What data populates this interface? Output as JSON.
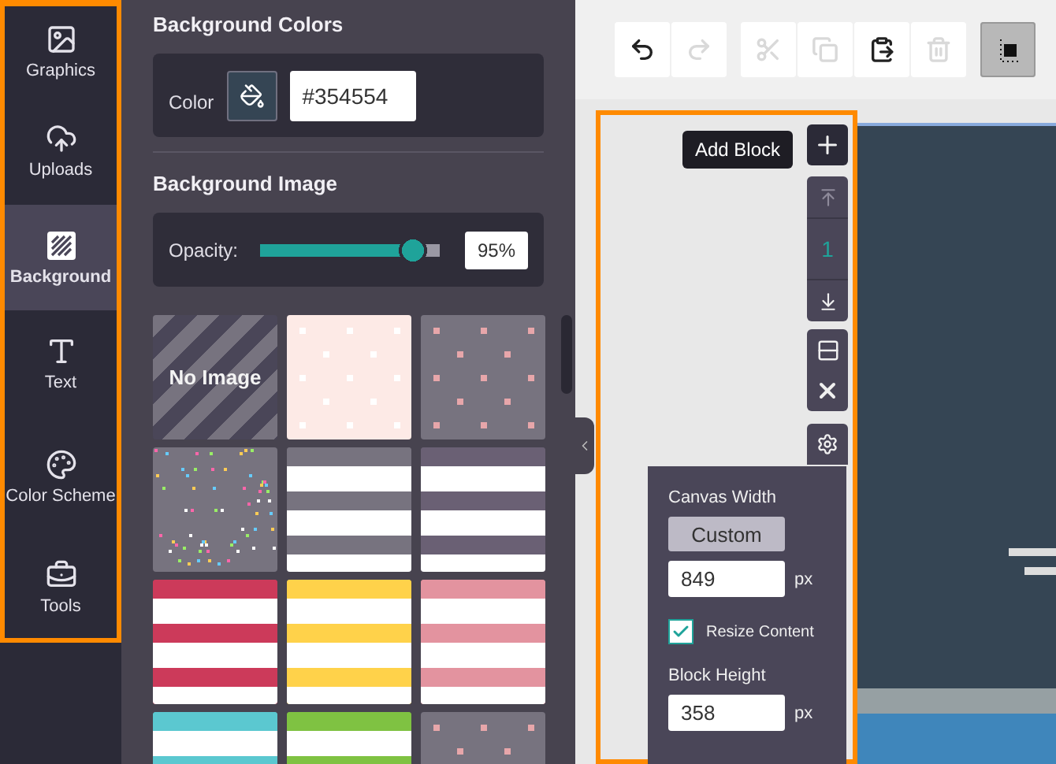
{
  "sidebar": {
    "items": [
      {
        "label": "Graphics",
        "selected": false
      },
      {
        "label": "Uploads",
        "selected": false
      },
      {
        "label": "Background",
        "selected": true
      },
      {
        "label": "Text",
        "selected": false
      },
      {
        "label": "Color Scheme",
        "selected": false
      },
      {
        "label": "Tools",
        "selected": false
      }
    ]
  },
  "panel": {
    "colors_title": "Background Colors",
    "color_label": "Color",
    "color_value": "#354554",
    "image_title": "Background Image",
    "opacity_label": "Opacity:",
    "opacity": {
      "level": 0.93
    },
    "opacity_value": "95%",
    "tiles": [
      {
        "kind": "none",
        "label": "No Image",
        "color": "#77737f"
      },
      {
        "kind": "dots",
        "color": "#fdeae6"
      },
      {
        "kind": "dots",
        "color": "#77737f"
      },
      {
        "kind": "confetti",
        "color": "#77737f"
      },
      {
        "kind": "stripes",
        "color": "#77737f"
      },
      {
        "kind": "stripes",
        "color": "#6a6074"
      },
      {
        "kind": "stripes",
        "color": "#cc3a5a"
      },
      {
        "kind": "stripes",
        "color": "#ffd24a"
      },
      {
        "kind": "stripes",
        "color": "#e3939f"
      },
      {
        "kind": "stripes",
        "color": "#5bc8d0"
      },
      {
        "kind": "stripes",
        "color": "#7fc242"
      },
      {
        "kind": "dots",
        "color": "#77737f"
      }
    ]
  },
  "toolbar": {
    "buttons": [
      {
        "disabled": false
      },
      {
        "disabled": true
      },
      {
        "disabled": true
      },
      {
        "disabled": true
      },
      {
        "disabled": false
      },
      {
        "disabled": true
      }
    ],
    "align_selected": true
  },
  "block_controls": {
    "tooltip": "Add Block",
    "block_number": "1",
    "move_up_disabled": true
  },
  "settings": {
    "canvas_width_label": "Canvas Width",
    "width_mode": "Custom",
    "width_value": "849",
    "width_unit": "px",
    "resize_label": "Resize Content",
    "resize_checked": true,
    "height_label": "Block Height",
    "height_value": "358",
    "height_unit": "px"
  }
}
